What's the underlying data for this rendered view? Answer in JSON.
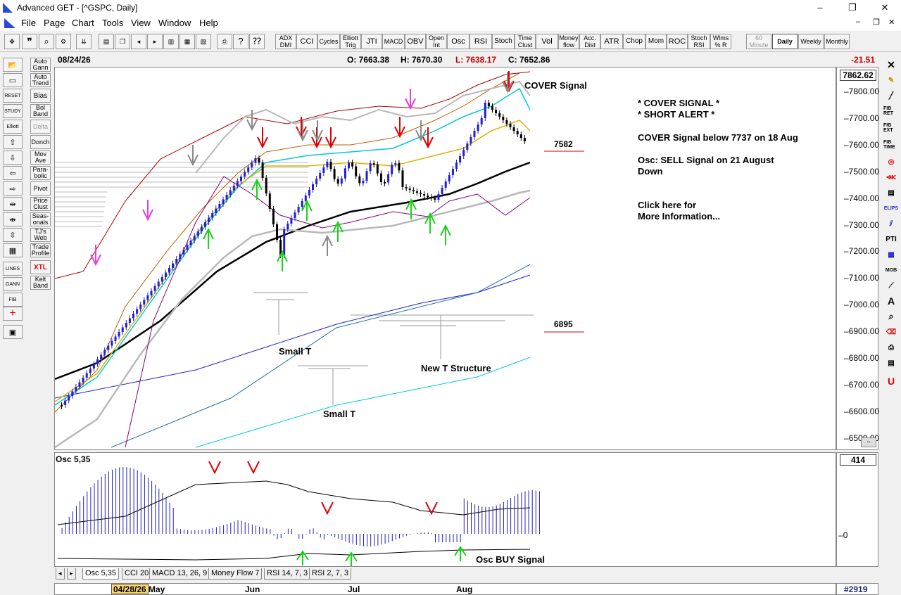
{
  "window": {
    "title": "Advanced GET - [^GSPC, Daily]",
    "min": "–",
    "max": "❐",
    "close": "✕"
  },
  "menu": [
    "File",
    "Page",
    "Chart",
    "Tools",
    "View",
    "Window",
    "Help"
  ],
  "mdi": {
    "min": "–",
    "restore": "❐",
    "close": "✕"
  },
  "toolbar_studies": [
    "ADX DMI",
    "CCI",
    "Cycles",
    "Elliott Trig",
    "JTI",
    "MACD",
    "OBV",
    "Open Int",
    "Osc",
    "RSI",
    "Stoch",
    "Time Clust",
    "Vol",
    "Money flow",
    "Acc. Dist",
    "ATR",
    "Chop",
    "Mom",
    "ROC",
    "Stoch RSI",
    "Wlms % R"
  ],
  "timeframes": [
    "60 Minute",
    "Daily",
    "Weekly",
    "Monthly"
  ],
  "active_timeframe": "Daily",
  "left_studies": [
    "Auto Gann",
    "Auto Trend",
    "Bias",
    "Bol Band",
    "Delta",
    "Donch",
    "Mov Ave",
    "Para-bolic",
    "Pivot",
    "Price Clust",
    "Seas-onals",
    "TJ's Web",
    "Trade Profile",
    "XTL",
    "Kelt Band"
  ],
  "left_tools": [
    "RESET",
    "STUDY",
    "Elliott",
    "LINES",
    "GANN",
    "FIB"
  ],
  "infobar": {
    "date": "08/24/26",
    "open": "O: 7663.38",
    "high": "H: 7670.30",
    "low": "L: 7638.17",
    "close": "C: 7652.86",
    "change": "-21.51"
  },
  "price_scale": {
    "top_value": "7862.62",
    "ticks": [
      "7800.00",
      "7700.00",
      "7600.00",
      "7500.00",
      "7400.00",
      "7300.00",
      "7200.00",
      "7100.00",
      "7000.00",
      "6900.00",
      "6800.00",
      "6700.00",
      "6600.00",
      "6500.00"
    ]
  },
  "annotations": {
    "cover_signal": "COVER Signal",
    "level_7582": "7582",
    "level_6895": "6895",
    "small_t_1": "Small T",
    "small_t_2": "Small T",
    "new_t": "New T Structure",
    "note_line1": "* COVER SIGNAL *",
    "note_line2": "* SHORT ALERT *",
    "note_line3": "COVER Signal below 7737 on 18 Aug",
    "note_line4": "Osc: SELL Signal on 21 August",
    "note_line5": "Down",
    "note_line6": "Click here for",
    "note_line7": "More Information..."
  },
  "oscillator": {
    "label": "Osc 5,35",
    "value": "414",
    "zero_tick": "0",
    "buy_signal": "Osc BUY Signal"
  },
  "tabs": [
    "Osc 5,35",
    "CCI 20",
    "MACD 13, 26, 9",
    "Money Flow 7",
    "RSI 14, 7, 3",
    "RSI 2, 7, 3"
  ],
  "date_axis": {
    "start": "04/28/26",
    "months": [
      "May",
      "Jun",
      "Jul",
      "Aug"
    ]
  },
  "bar_count": "#2919",
  "colors": {
    "up_candle": "#1f1fd6",
    "down_candle": "#000000",
    "sell_arrow": "#e00000",
    "buy_arrow": "#16d416",
    "neutral_arrow": "#8a8a8a",
    "magenta_arrow": "#e040e0"
  }
}
